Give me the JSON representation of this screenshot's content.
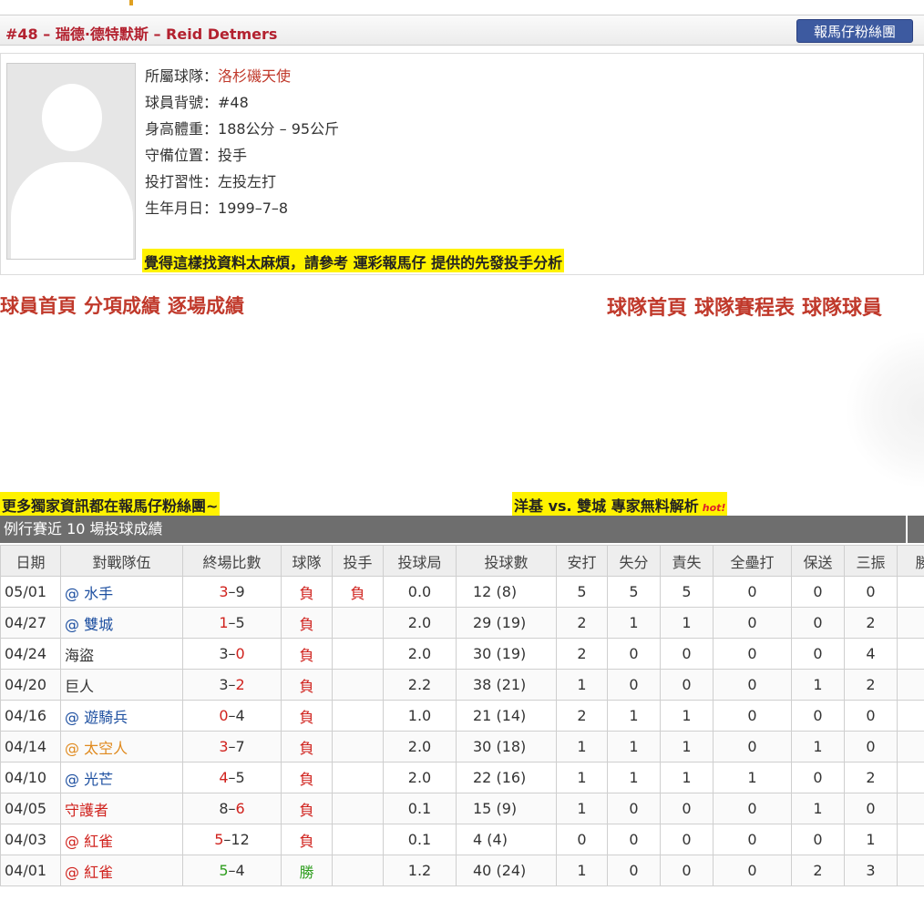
{
  "player": {
    "title": "#48 – 瑞德·德特默斯 – Reid Detmers",
    "fan_button": "報馬仔粉絲團",
    "info": [
      {
        "label": "所屬球隊：",
        "value": "洛杉磯天使"
      },
      {
        "label": "球員背號：",
        "value": "#48"
      },
      {
        "label": "身高體重：",
        "value": "188公分 – 95公斤"
      },
      {
        "label": "守備位置：",
        "value": "投手"
      },
      {
        "label": "投打習性：",
        "value": "左投左打"
      },
      {
        "label": "生年月日：",
        "value": "1999–7–8"
      }
    ],
    "promo": "覺得這樣找資料太麻煩，請參考 運彩報馬仔 提供的先發投手分析"
  },
  "nav": {
    "player_links": [
      "球員首頁",
      "分項成績",
      "逐場成績"
    ],
    "team_links": [
      "球隊首頁",
      "球隊賽程表",
      "球隊球員"
    ]
  },
  "promos": {
    "left": "更多獨家資訊都在報馬仔粉絲團~",
    "right": "洋基 vs. 雙城 專家無料解析",
    "hot": "hot!"
  },
  "stats": {
    "title": "例行賽近 10 場投球成績",
    "columns": [
      "日期",
      "對戰隊伍",
      "終場比數",
      "球隊",
      "投手",
      "投球局",
      "投球數",
      "安打",
      "失分",
      "責失",
      "全壘打",
      "保送",
      "三振",
      "勝"
    ],
    "rows": [
      {
        "date": "05/01",
        "away": "@",
        "opp": "水手",
        "opp_color": "blue",
        "s1": "3",
        "s1_color": "red",
        "s2": "9",
        "s2_color": "",
        "team": "負",
        "team_color": "red",
        "pitcher": "負",
        "ip": "0.0",
        "pc": "12 (8)",
        "h": "5",
        "r": "5",
        "er": "5",
        "hr": "0",
        "bb": "0",
        "so": "0"
      },
      {
        "date": "04/27",
        "away": "@",
        "opp": "雙城",
        "opp_color": "blue",
        "s1": "1",
        "s1_color": "red",
        "s2": "5",
        "s2_color": "",
        "team": "負",
        "team_color": "red",
        "pitcher": "",
        "ip": "2.0",
        "pc": "29 (19)",
        "h": "2",
        "r": "1",
        "er": "1",
        "hr": "0",
        "bb": "0",
        "so": "2"
      },
      {
        "date": "04/24",
        "away": "",
        "opp": "海盜",
        "opp_color": "",
        "s1": "3",
        "s1_color": "",
        "s2": "0",
        "s2_color": "red",
        "team": "負",
        "team_color": "red",
        "pitcher": "",
        "ip": "2.0",
        "pc": "30 (19)",
        "h": "2",
        "r": "0",
        "er": "0",
        "hr": "0",
        "bb": "0",
        "so": "4"
      },
      {
        "date": "04/20",
        "away": "",
        "opp": "巨人",
        "opp_color": "",
        "s1": "3",
        "s1_color": "",
        "s2": "2",
        "s2_color": "red",
        "team": "負",
        "team_color": "red",
        "pitcher": "",
        "ip": "2.2",
        "pc": "38 (21)",
        "h": "1",
        "r": "0",
        "er": "0",
        "hr": "0",
        "bb": "1",
        "so": "2"
      },
      {
        "date": "04/16",
        "away": "@",
        "opp": "遊騎兵",
        "opp_color": "blue",
        "s1": "0",
        "s1_color": "red",
        "s2": "4",
        "s2_color": "",
        "team": "負",
        "team_color": "red",
        "pitcher": "",
        "ip": "1.0",
        "pc": "21 (14)",
        "h": "2",
        "r": "1",
        "er": "1",
        "hr": "0",
        "bb": "0",
        "so": "0"
      },
      {
        "date": "04/14",
        "away": "@",
        "opp": "太空人",
        "opp_color": "orange",
        "s1": "3",
        "s1_color": "red",
        "s2": "7",
        "s2_color": "",
        "team": "負",
        "team_color": "red",
        "pitcher": "",
        "ip": "2.0",
        "pc": "30 (18)",
        "h": "1",
        "r": "1",
        "er": "1",
        "hr": "0",
        "bb": "1",
        "so": "0"
      },
      {
        "date": "04/10",
        "away": "@",
        "opp": "光芒",
        "opp_color": "blue",
        "s1": "4",
        "s1_color": "red",
        "s2": "5",
        "s2_color": "",
        "team": "負",
        "team_color": "red",
        "pitcher": "",
        "ip": "2.0",
        "pc": "22 (16)",
        "h": "1",
        "r": "1",
        "er": "1",
        "hr": "1",
        "bb": "0",
        "so": "2"
      },
      {
        "date": "04/05",
        "away": "",
        "opp": "守護者",
        "opp_color": "red",
        "s1": "8",
        "s1_color": "",
        "s2": "6",
        "s2_color": "red",
        "team": "負",
        "team_color": "red",
        "pitcher": "",
        "ip": "0.1",
        "pc": "15 (9)",
        "h": "1",
        "r": "0",
        "er": "0",
        "hr": "0",
        "bb": "1",
        "so": "0"
      },
      {
        "date": "04/03",
        "away": "@",
        "opp": "紅雀",
        "opp_color": "red",
        "s1": "5",
        "s1_color": "red",
        "s2": "12",
        "s2_color": "",
        "team": "負",
        "team_color": "red",
        "pitcher": "",
        "ip": "0.1",
        "pc": "4 (4)",
        "h": "0",
        "r": "0",
        "er": "0",
        "hr": "0",
        "bb": "0",
        "so": "1"
      },
      {
        "date": "04/01",
        "away": "@",
        "opp": "紅雀",
        "opp_color": "red",
        "s1": "5",
        "s1_color": "green",
        "s2": "4",
        "s2_color": "",
        "team": "勝",
        "team_color": "green",
        "pitcher": "",
        "ip": "1.2",
        "pc": "40 (24)",
        "h": "1",
        "r": "0",
        "er": "0",
        "hr": "0",
        "bb": "2",
        "so": "3"
      }
    ]
  },
  "colors": {
    "accent_red": "#b3212f",
    "fan_button_bg": "#3d5aa0",
    "highlight_yellow": "#fff200",
    "table_header_bg": "#6e6e6e",
    "win_green": "#2f9e1f",
    "loss_red": "#d0221d",
    "opponent_blue": "#1d4fa0",
    "opponent_orange": "#e08a1e"
  }
}
